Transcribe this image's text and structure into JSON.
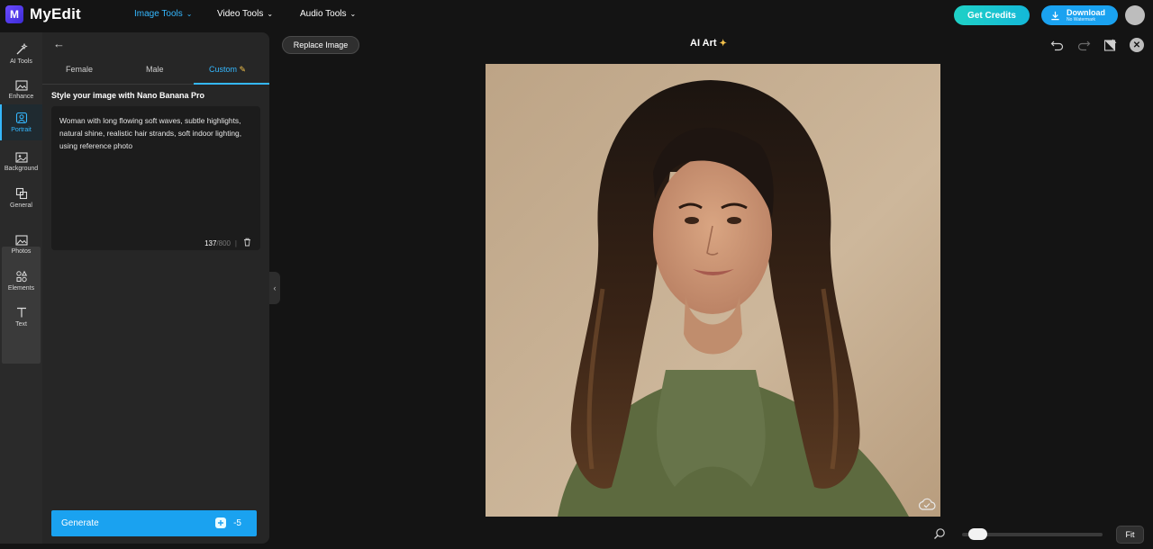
{
  "app": {
    "brand": "MyEdit",
    "logo_letter": "M"
  },
  "nav": {
    "image_tools": "Image Tools",
    "video_tools": "Video Tools",
    "audio_tools": "Audio Tools"
  },
  "header": {
    "get_credits": "Get Credits",
    "download": "Download",
    "download_sub": "No Watermark"
  },
  "rail": {
    "ai_tools": "AI Tools",
    "enhance": "Enhance",
    "portrait": "Portrait",
    "background": "Background",
    "general": "General",
    "photos": "Photos",
    "elements": "Elements",
    "text": "Text"
  },
  "panel": {
    "tabs": [
      "Female",
      "Male",
      "Custom"
    ],
    "active_tab": "Custom",
    "style_title": "Style your image with Nano Banana Pro",
    "prompt": "Woman with long flowing soft waves, subtle highlights, natural shine, realistic hair strands, soft indoor lighting, using reference photo",
    "char_count": "137",
    "char_max": "/800",
    "generate_label": "Generate",
    "generate_cost": "-5"
  },
  "canvas": {
    "replace_image": "Replace Image",
    "title": "AI Art",
    "fit": "Fit",
    "zoom_level": 0.05
  },
  "colors": {
    "accent": "#35b8ff",
    "primary_button": "#1aa2f0",
    "credits_start": "#1fd1c6"
  },
  "icons": {
    "undo": "undo-icon",
    "redo": "redo-icon",
    "compare": "compare-icon",
    "close": "close-icon",
    "cloud": "cloud-save-icon",
    "zoom": "zoom-icon"
  }
}
